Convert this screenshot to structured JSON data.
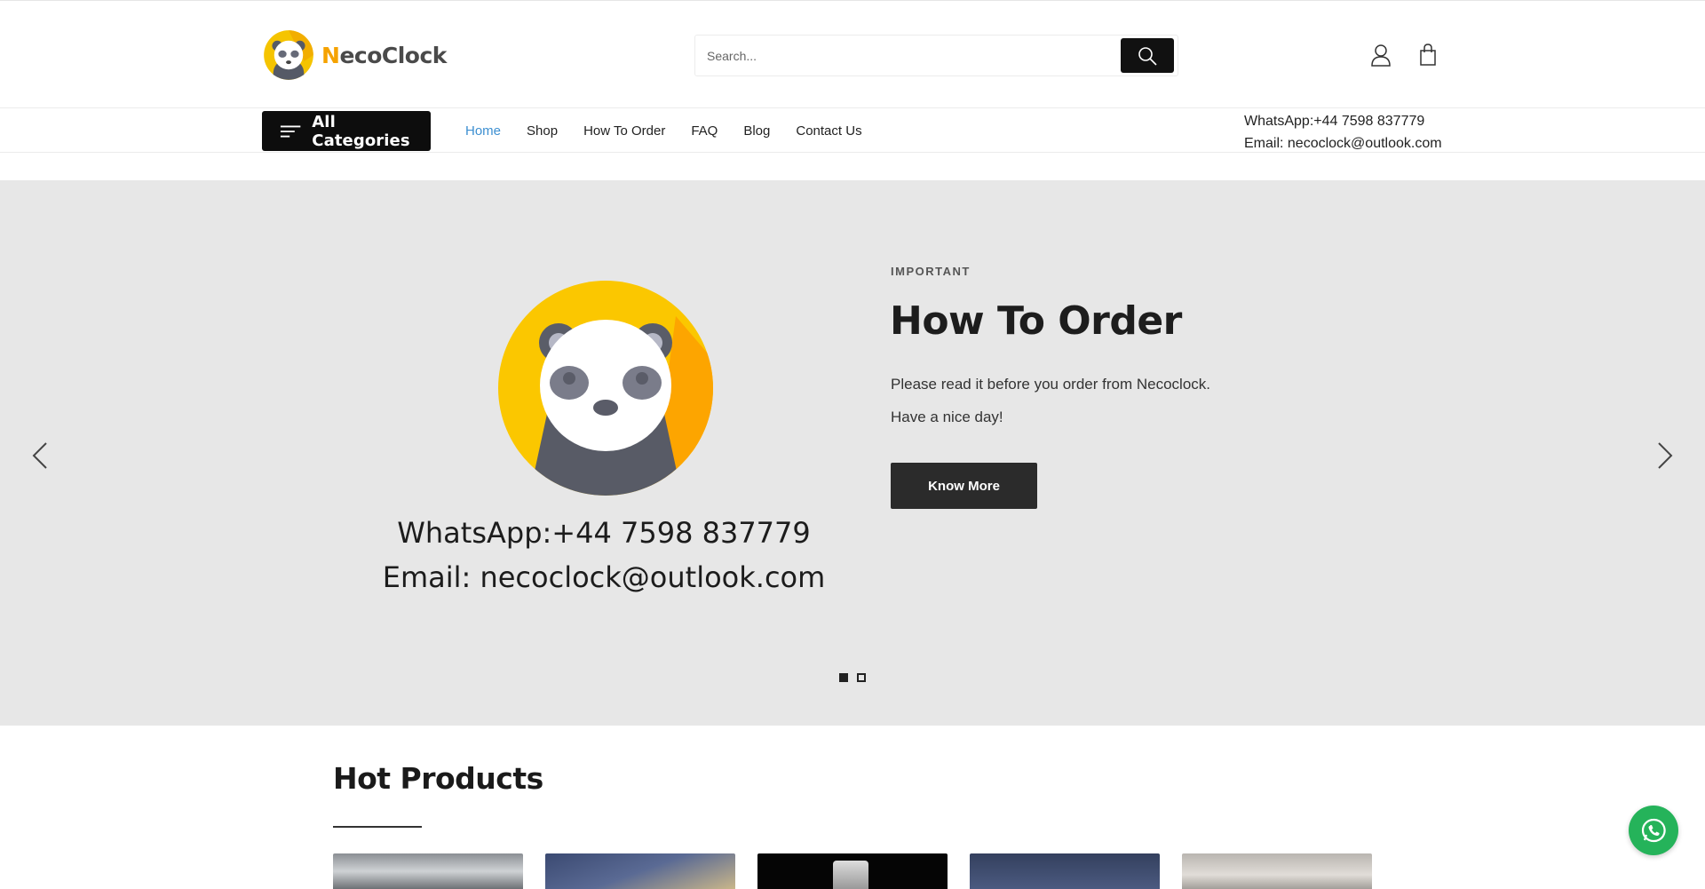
{
  "brand": {
    "name": "NecoClock",
    "name_first": "N",
    "name_rest": "ecoClock"
  },
  "search": {
    "placeholder": "Search...",
    "value": ""
  },
  "header_icons": [
    "search-icon",
    "user-icon",
    "shopping-bag-icon"
  ],
  "nav": {
    "all_categories": "All Categories",
    "links": [
      {
        "label": "Home",
        "active": true
      },
      {
        "label": "Shop",
        "active": false
      },
      {
        "label": "How To Order",
        "active": false
      },
      {
        "label": "FAQ",
        "active": false
      },
      {
        "label": "Blog",
        "active": false
      },
      {
        "label": "Contact Us",
        "active": false
      }
    ]
  },
  "contact": {
    "whatsapp": "WhatsApp:+44 7598 837779",
    "email": "Email: necoclock@outlook.com"
  },
  "hero": {
    "image_whatsapp": "WhatsApp:+44 7598 837779",
    "image_email": "Email: necoclock@outlook.com",
    "eyebrow": "IMPORTANT",
    "title": "How To Order",
    "line1": "Please read it before you order from Necoclock.",
    "line2": "Have a nice day!",
    "button": "Know More",
    "slides_total": 2,
    "slide_active": 1
  },
  "hot_products": {
    "title": "Hot Products",
    "count_visible": 5
  },
  "colors": {
    "accent_link": "#3d8fd1",
    "brand_yellow": "#f5c400",
    "hero_bg": "#e7e7e7",
    "whatsapp_green": "#25b35a"
  }
}
